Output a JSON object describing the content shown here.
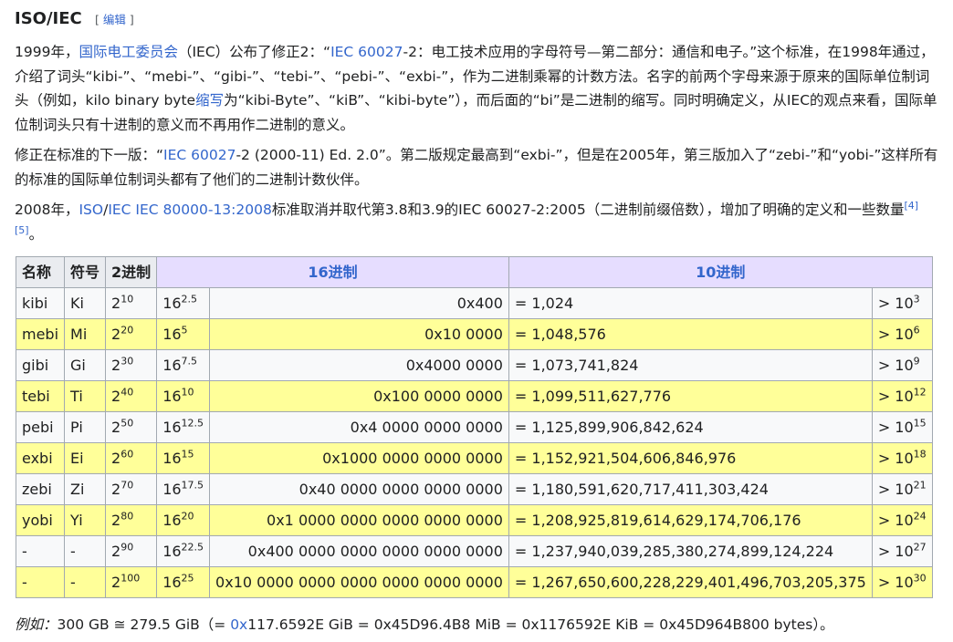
{
  "heading": {
    "title": "ISO/IEC",
    "edit_open": "[",
    "edit_label": "编辑",
    "edit_close": "]"
  },
  "para1": {
    "t1": "1999年，",
    "link_iec": "国际电工委员会",
    "t2": "（IEC）公布了修正2：“",
    "link_std": "IEC 60027",
    "t3": "-2：电工技术应用的字母符号—第二部分：通信和电子。”这个标准，在1998年通过，介绍了词头“kibi-”、“mebi-”、“gibi-”、“tebi-”、“pebi-”、“exbi-”，作为二进制乘幂的计数方法。名字的前两个字母来源于原来的国际单位制词头（例如，kilo binary byte",
    "link_abbr": "缩写",
    "t4": "为“kibi-Byte”、“kiB”、“kibi-byte”），而后面的“bi”是二进制的缩写。同时明确定义，从IEC的观点来看，国际单位制词头只有十进制的意义而不再用作二进制的意义。"
  },
  "para2": {
    "t1": "修正在标准的下一版：“",
    "link_std": "IEC 60027",
    "t2": "-2 (2000-11) Ed. 2.0”。第二版规定最高到“exbi-”，但是在2005年，第三版加入了“zebi-”和“yobi-”这样所有的标准的国际单位制词头都有了他们的二进制计数伙伴。"
  },
  "para3": {
    "t1": "2008年，",
    "link_iso": "ISO",
    "slash": "/",
    "link_iec": "IEC IEC 80000-13:2008",
    "t2": "标准取消并取代第3.8和3.9的IEC 60027-2:2005（二进制前缀倍数），增加了明确的定义和一些数量",
    "ref1": "[4]",
    "ref2": "[5]",
    "t3": "。"
  },
  "table": {
    "headers": {
      "name": "名称",
      "symbol": "符号",
      "binary": "2进制",
      "hex": "16进制",
      "decimal": "10进制"
    },
    "rows": [
      {
        "name": "kibi",
        "sym": "Ki",
        "bin_base": "2",
        "bin_exp": "10",
        "hex_base": "16",
        "hex_exp": "2.5",
        "hex_val": "0x400",
        "dec_val": "= 1,024",
        "cmp_base": "> 10",
        "cmp_exp": "3"
      },
      {
        "name": "mebi",
        "sym": "Mi",
        "bin_base": "2",
        "bin_exp": "20",
        "hex_base": "16",
        "hex_exp": "5",
        "hex_val": "0x10 0000",
        "dec_val": "= 1,048,576",
        "cmp_base": "> 10",
        "cmp_exp": "6"
      },
      {
        "name": "gibi",
        "sym": "Gi",
        "bin_base": "2",
        "bin_exp": "30",
        "hex_base": "16",
        "hex_exp": "7.5",
        "hex_val": "0x4000 0000",
        "dec_val": "= 1,073,741,824",
        "cmp_base": "> 10",
        "cmp_exp": "9"
      },
      {
        "name": "tebi",
        "sym": "Ti",
        "bin_base": "2",
        "bin_exp": "40",
        "hex_base": "16",
        "hex_exp": "10",
        "hex_val": "0x100 0000 0000",
        "dec_val": "= 1,099,511,627,776",
        "cmp_base": "> 10",
        "cmp_exp": "12"
      },
      {
        "name": "pebi",
        "sym": "Pi",
        "bin_base": "2",
        "bin_exp": "50",
        "hex_base": "16",
        "hex_exp": "12.5",
        "hex_val": "0x4 0000 0000 0000",
        "dec_val": "= 1,125,899,906,842,624",
        "cmp_base": "> 10",
        "cmp_exp": "15"
      },
      {
        "name": "exbi",
        "sym": "Ei",
        "bin_base": "2",
        "bin_exp": "60",
        "hex_base": "16",
        "hex_exp": "15",
        "hex_val": "0x1000 0000 0000 0000",
        "dec_val": "= 1,152,921,504,606,846,976",
        "cmp_base": "> 10",
        "cmp_exp": "18"
      },
      {
        "name": "zebi",
        "sym": "Zi",
        "bin_base": "2",
        "bin_exp": "70",
        "hex_base": "16",
        "hex_exp": "17.5",
        "hex_val": "0x40 0000 0000 0000 0000",
        "dec_val": "= 1,180,591,620,717,411,303,424",
        "cmp_base": "> 10",
        "cmp_exp": "21"
      },
      {
        "name": "yobi",
        "sym": "Yi",
        "bin_base": "2",
        "bin_exp": "80",
        "hex_base": "16",
        "hex_exp": "20",
        "hex_val": "0x1 0000 0000 0000 0000 0000",
        "dec_val": "= 1,208,925,819,614,629,174,706,176",
        "cmp_base": "> 10",
        "cmp_exp": "24"
      },
      {
        "name": "-",
        "sym": "-",
        "bin_base": "2",
        "bin_exp": "90",
        "hex_base": "16",
        "hex_exp": "22.5",
        "hex_val": "0x400 0000 0000 0000 0000 0000",
        "dec_val": "= 1,237,940,039,285,380,274,899,124,224",
        "cmp_base": "> 10",
        "cmp_exp": "27"
      },
      {
        "name": "-",
        "sym": "-",
        "bin_base": "2",
        "bin_exp": "100",
        "hex_base": "16",
        "hex_exp": "25",
        "hex_val": "0x10 0000 0000 0000 0000 0000 0000",
        "dec_val": "= 1,267,650,600,228,229,401,496,703,205,375",
        "cmp_base": "> 10",
        "cmp_exp": "30"
      }
    ]
  },
  "example": {
    "label": "例如：",
    "t1": "300 GB ≅ 279.5 GiB（= ",
    "link": "0x",
    "t2": "117.6592E GiB = 0x45D96.4B8 MiB = 0x1176592E KiB = 0x45D964B800 bytes）。"
  },
  "colors": {
    "link": "#3366cc",
    "header_bg": "#eaecf0",
    "header_purple": "#e6ddff",
    "row_yellow": "#ffff99",
    "row_light": "#f8f9fa",
    "border": "#a2a9b1"
  }
}
